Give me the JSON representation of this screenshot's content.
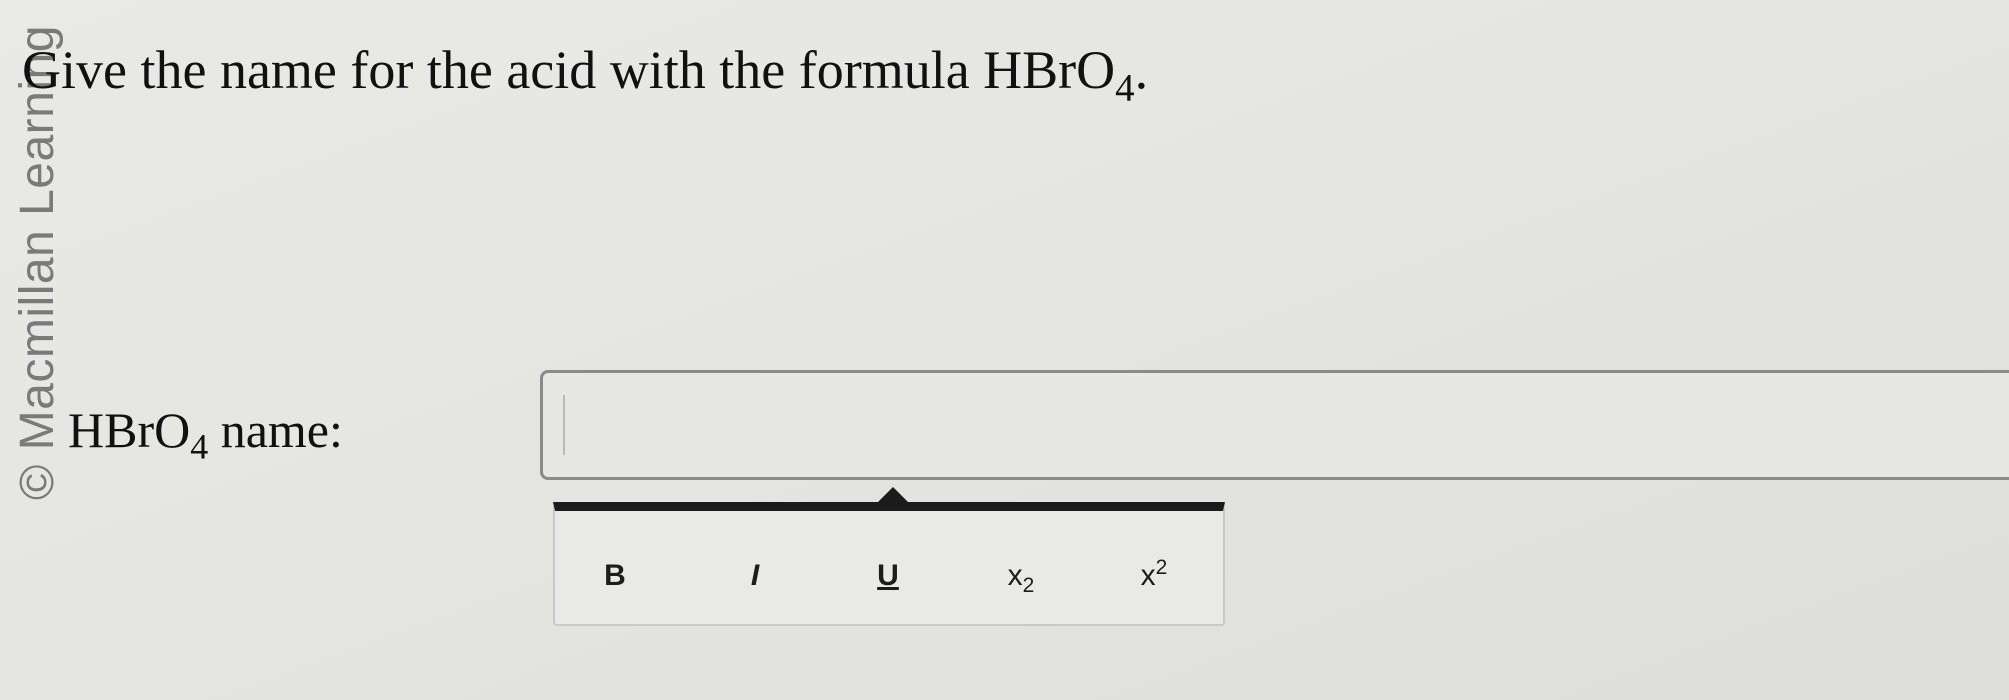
{
  "watermark": "© Macmillan Learning",
  "question": {
    "text": "Give the name for the acid with the formula HBrO",
    "formula_subscript": "4",
    "end_punct": "."
  },
  "answer": {
    "label_formula": "HBrO",
    "label_subscript": "4",
    "label_suffix": " name:",
    "value": "",
    "placeholder": ""
  },
  "toolbar": {
    "bold_label": "B",
    "italic_label": "I",
    "underline_label": "U",
    "subscript_base": "x",
    "subscript_mark": "2",
    "superscript_base": "x",
    "superscript_mark": "2"
  },
  "colors": {
    "background": "#e6e6e3",
    "toolbar_border": "#1b1b1b",
    "input_border": "#8a8a8a"
  },
  "icons": [
    "bold-icon",
    "italic-icon",
    "underline-icon",
    "subscript-icon",
    "superscript-icon"
  ]
}
